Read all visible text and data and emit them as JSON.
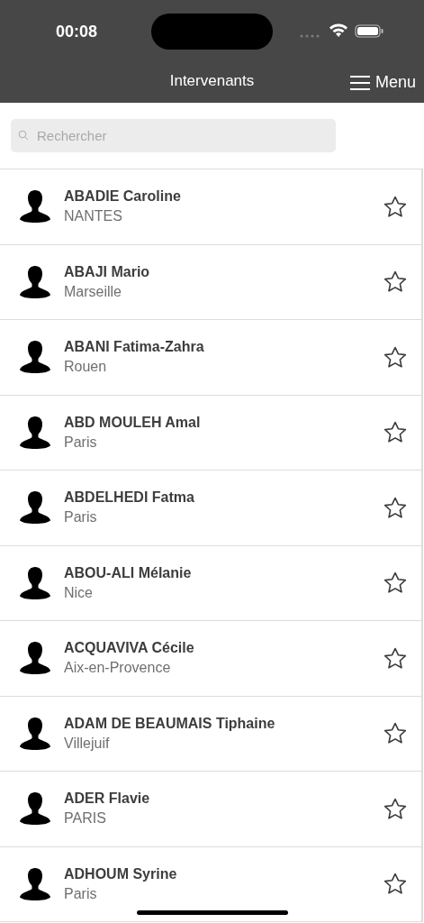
{
  "status_bar": {
    "time": "00:08"
  },
  "nav_bar": {
    "title": "Intervenants",
    "menu_label": "Menu"
  },
  "search": {
    "placeholder": "Rechercher"
  },
  "contacts": [
    {
      "name": "ABADIE Caroline",
      "city": "NANTES",
      "favorite": false
    },
    {
      "name": "ABAJI Mario",
      "city": "Marseille",
      "favorite": false
    },
    {
      "name": "ABANI Fatima-Zahra",
      "city": "Rouen",
      "favorite": false
    },
    {
      "name": "ABD MOULEH Amal",
      "city": "Paris",
      "favorite": false
    },
    {
      "name": "ABDELHEDI Fatma",
      "city": "Paris",
      "favorite": false
    },
    {
      "name": "ABOU-ALI Mélanie",
      "city": "Nice",
      "favorite": false
    },
    {
      "name": "ACQUAVIVA Cécile",
      "city": "Aix-en-Provence",
      "favorite": false
    },
    {
      "name": "ADAM DE BEAUMAIS Tiphaine",
      "city": "Villejuif",
      "favorite": false
    },
    {
      "name": "ADER Flavie",
      "city": "PARIS",
      "favorite": false
    },
    {
      "name": "ADHOUM Syrine",
      "city": "Paris",
      "favorite": false
    }
  ]
}
